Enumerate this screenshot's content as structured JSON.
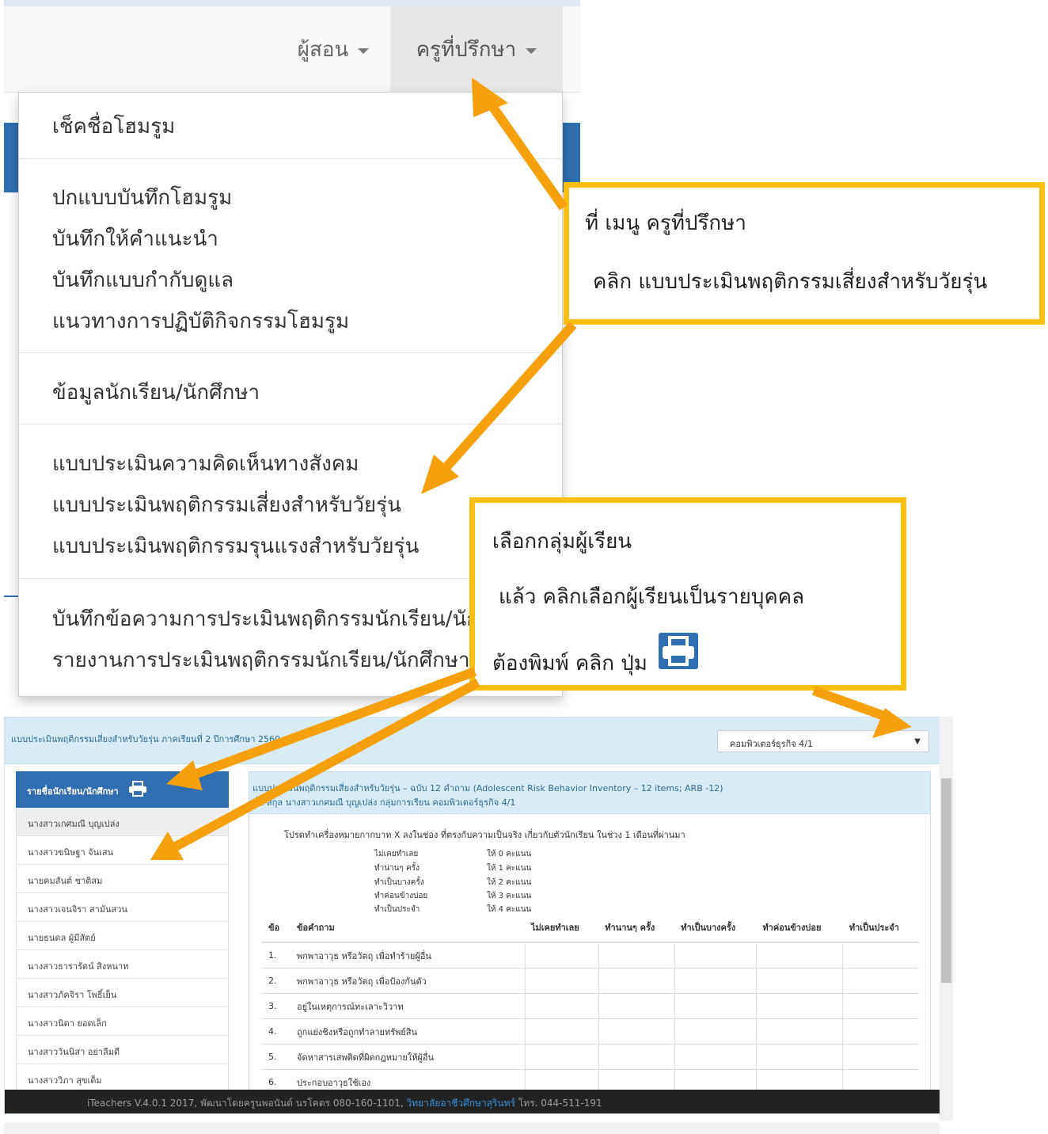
{
  "navbar": {
    "teacher_label": "ผู้สอน",
    "advisor_label": "ครูที่ปรึกษา"
  },
  "dropdown": {
    "items": [
      "เช็คชื่อโฮมรูม",
      "ปกแบบบันทึกโฮมรูม",
      "บันทึกให้คำแนะนำ",
      "บันทึกแบบกำกับดูแล",
      "แนวทางการปฏิบัติกิจกรรมโฮมรูม",
      "ข้อมูลนักเรียน/นักศึกษา",
      "แบบประเมินความคิดเห็นทางสังคม",
      "แบบประเมินพฤติกรรมเสี่ยงสำหรับวัยรุ่น",
      "แบบประเมินพฤติกรรมรุนแรงสำหรับวัยรุ่น",
      "บันทึกข้อความการประเมินพฤติกรรมนักเรียน/นัก",
      "รายงานการประเมินพฤติกรรมนักเรียน/นักศึกษา"
    ]
  },
  "callout1": {
    "line1": "ที่ เมนู ครูที่ปรึกษา",
    "line2": "คลิก แบบประเมินพฤติกรรมเสี่ยงสำหรับวัยรุ่น"
  },
  "callout2": {
    "line1": "เลือกกลุ่มผู้เรียน",
    "line2": "แล้ว คลิกเลือกผู้เรียนเป็นรายบุคคล",
    "line3": "ต้องพิมพ์ คลิก ปุ่ม"
  },
  "app": {
    "title": "แบบประเมินพฤติกรรมเสี่ยงสำหรับวัยรุ่น ภาคเรียนที่ 2 ปีการศึกษา 2560",
    "class_select": "คอมพิวเตอร์ธุรกิจ 4/1",
    "list_title": "รายชื่อนักเรียน/นักศึกษา",
    "students": [
      "นางสาวเกศมณี บุญเปล่ง",
      "นางสาวขนิษฐา จันเสน",
      "นายคมสันต์ ชาติสม",
      "นางสาวเจนจิรา สามันสวน",
      "นายธนดล ผู้มีสัตย์",
      "นางสาวธารารัตน์ สิงหนาท",
      "นางสาวภัคจิรา โพธิ์เย็น",
      "นางสาวนิดา ยอดเล็ก",
      "นางสาววันนิสา อย่าลืมดี",
      "นางสาววิภา สุขเต็ม"
    ],
    "panel_line1": "แบบประเมินพฤติกรรมเสี่ยงสำหรับวัยรุ่น – ฉบับ 12 คำถาม (Adolescent Risk Behavior Inventory – 12 items; ARB -12)",
    "panel_line2": "ชื่อ-สกุล นางสาวเกศมณี บุญเปล่ง กลุ่มการเรียน คอมพิวเตอร์ธุรกิจ 4/1",
    "instruction": "โปรดทำเครื่องหมายกากบาท X ลงในช่อง ที่ตรงกับความเป็นจริง เกี่ยวกับตัวนักเรียน ในช่วง 1 เดือนที่ผ่านมา",
    "legend": [
      {
        "label": "ไม่เคยทำเลย",
        "score": "ให้ 0 คะแนน"
      },
      {
        "label": "ทำนานๆ ครั้ง",
        "score": "ให้ 1 คะแนน"
      },
      {
        "label": "ทำเป็นบางครั้ง",
        "score": "ให้ 2 คะแนน"
      },
      {
        "label": "ทำค่อนข้างบ่อย",
        "score": "ให้ 3 คะแนน"
      },
      {
        "label": "ทำเป็นประจำ",
        "score": "ให้ 4 คะแนน"
      }
    ],
    "table_headers": [
      "ข้อ",
      "ข้อคำถาม",
      "ไม่เคยทำเลย",
      "ทำนานๆ ครั้ง",
      "ทำเป็นบางครั้ง",
      "ทำค่อนข้างบ่อย",
      "ทำเป็นประจำ"
    ],
    "questions": [
      {
        "no": "1.",
        "text": "พกพาอาวุธ หรือวัตถุ เพื่อทำร้ายผู้อื่น"
      },
      {
        "no": "2.",
        "text": "พกพาอาวุธ หรือวัตถุ เพื่อป้องกันตัว"
      },
      {
        "no": "3.",
        "text": "อยู่ในเหตุการณ์ทะเลาะวิวาท"
      },
      {
        "no": "4.",
        "text": "ถูกแย่งชิงหรือถูกทำลายทรัพย์สิน"
      },
      {
        "no": "5.",
        "text": "จัดหาสารเสพติดที่ผิดกฎหมายให้ผู้อื่น"
      },
      {
        "no": "6.",
        "text": "ประกอบอาวุธใช้เอง"
      }
    ],
    "footer_text": "iTeachers V.4.0.1 2017, พัฒนาโดยครูนพอนันต์ นรโคตร 080-160-1101, ",
    "footer_link": "วิทยาลัยอาชีวศึกษาสุรินทร์",
    "footer_tel": " โทร. 044-511-191"
  },
  "colors": {
    "accent_blue": "#2f6fb1",
    "arrow_orange": "#f6a00c",
    "callout_border": "#fbbf0f"
  }
}
